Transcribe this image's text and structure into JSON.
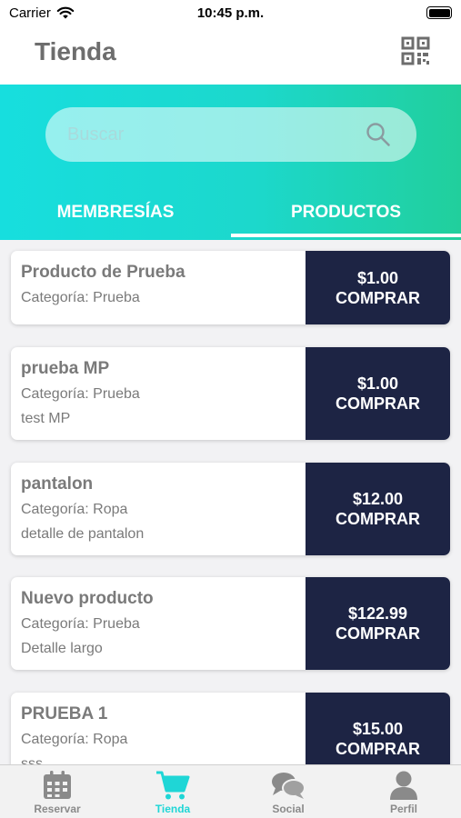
{
  "status_bar": {
    "carrier": "Carrier",
    "time": "10:45 p.m."
  },
  "header": {
    "title": "Tienda"
  },
  "search": {
    "placeholder": "Buscar"
  },
  "tabs": [
    {
      "label": "MEMBRESÍAS",
      "active": false
    },
    {
      "label": "PRODUCTOS",
      "active": true
    }
  ],
  "products": [
    {
      "name": "Producto de Prueba",
      "category_label": "Categoría:",
      "category": "Prueba",
      "detail": "",
      "price": "$1.00",
      "action": "COMPRAR"
    },
    {
      "name": "prueba MP",
      "category_label": "Categoría:",
      "category": "Prueba",
      "detail": "test MP",
      "price": "$1.00",
      "action": "COMPRAR"
    },
    {
      "name": "pantalon",
      "category_label": "Categoría:",
      "category": "Ropa",
      "detail": "detalle de pantalon",
      "price": "$12.00",
      "action": "COMPRAR"
    },
    {
      "name": "Nuevo producto",
      "category_label": "Categoría:",
      "category": "Prueba",
      "detail": "Detalle largo",
      "price": "$122.99",
      "action": "COMPRAR"
    },
    {
      "name": "PRUEBA 1",
      "category_label": "Categoría:",
      "category": "Ropa",
      "detail": "sss",
      "price": "$15.00",
      "action": "COMPRAR"
    }
  ],
  "tabbar": [
    {
      "label": "Reservar",
      "icon": "calendar-icon",
      "active": false
    },
    {
      "label": "Tienda",
      "icon": "cart-icon",
      "active": true
    },
    {
      "label": "Social",
      "icon": "chat-bubbles-icon",
      "active": false
    },
    {
      "label": "Perfil",
      "icon": "person-icon",
      "active": false
    }
  ],
  "colors": {
    "accent": "#1fd6d6",
    "gradient_start": "#17dede",
    "gradient_end": "#21cf9c",
    "buy_button": "#1d2444",
    "title_gray": "#6d6d6d"
  }
}
